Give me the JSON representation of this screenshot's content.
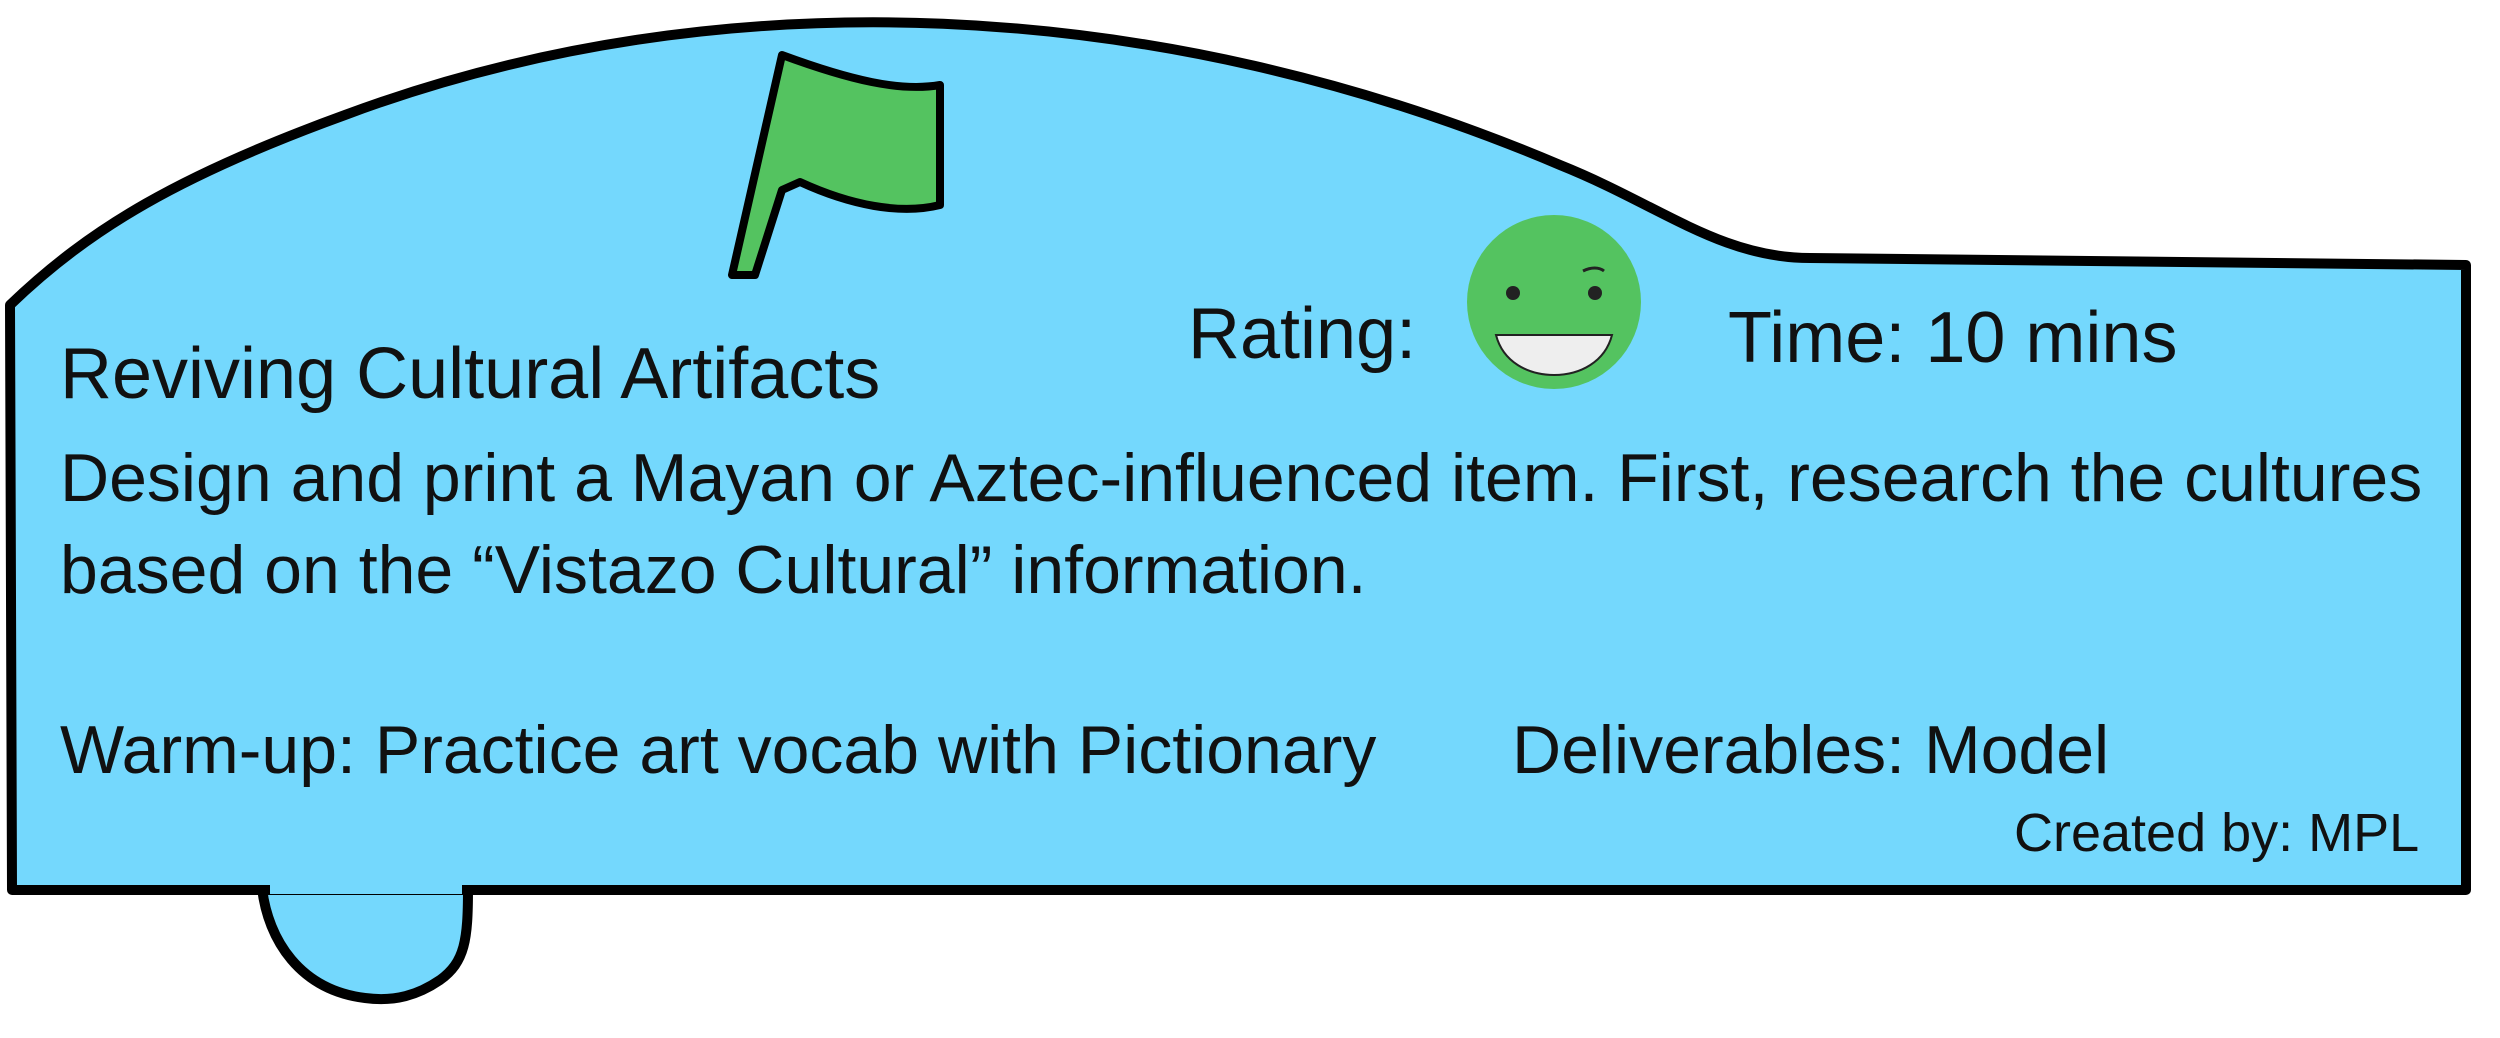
{
  "card": {
    "title": "Reviving Cultural Artifacts",
    "rating_label": "Rating:",
    "rating_icon": "smiling-face-icon",
    "flag_icon": "green-flag-icon",
    "time_label": "Time: 10 mins",
    "description": "Design and print a Mayan or Aztec-influenced item. First, research the cultures based on the “Vistazo Cultural” information.",
    "warmup": "Warm-up: Practice art vocab with Pictionary",
    "deliverables": "Deliverables: Model",
    "creator": "Created by: MPL"
  },
  "colors": {
    "card_fill": "#74d8fd",
    "outline": "#000000",
    "flag": "#54c360",
    "face": "#54c360",
    "text": "#111111"
  }
}
